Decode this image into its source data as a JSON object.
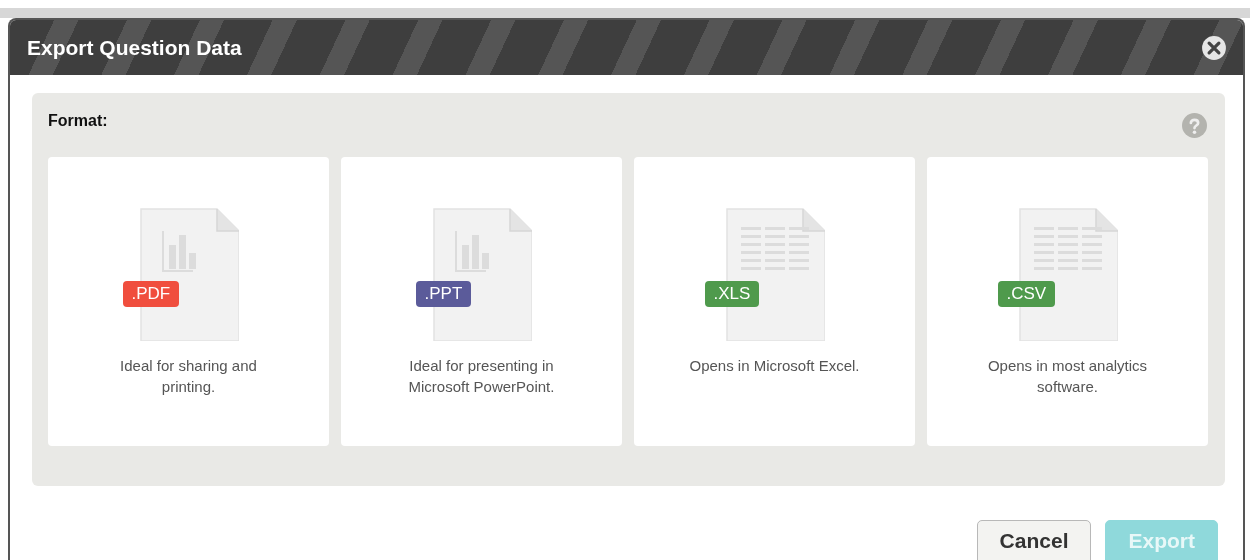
{
  "dialog": {
    "title": "Export Question Data"
  },
  "format": {
    "label": "Format:",
    "options": [
      {
        "kind": "chart",
        "badge": ".PDF",
        "color": "#f04e3e",
        "description": "Ideal for sharing and printing."
      },
      {
        "kind": "chart",
        "badge": ".PPT",
        "color": "#5b5b9a",
        "description": "Ideal for presenting in Microsoft PowerPoint."
      },
      {
        "kind": "sheet",
        "badge": ".XLS",
        "color": "#4f9a4c",
        "description": "Opens in Microsoft Excel."
      },
      {
        "kind": "sheet",
        "badge": ".CSV",
        "color": "#4f9a4c",
        "description": "Opens in most analytics software."
      }
    ]
  },
  "buttons": [
    {
      "label": "Cancel",
      "kind": "secondary",
      "disabled": false
    },
    {
      "label": "Export",
      "kind": "primary",
      "disabled": true
    }
  ]
}
